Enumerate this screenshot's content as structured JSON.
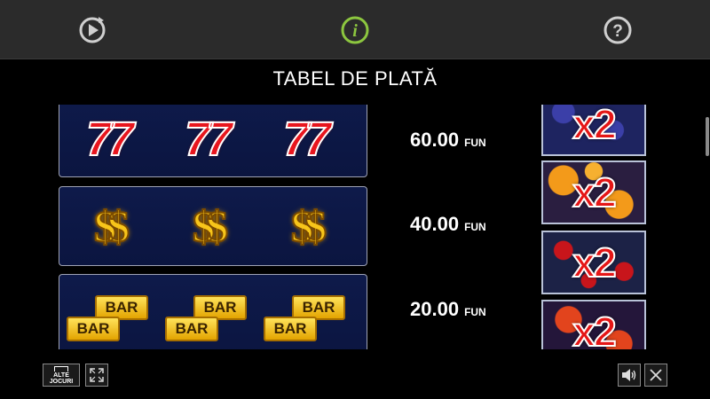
{
  "header": {
    "replay_icon": "replay-icon",
    "info_icon": "info-icon",
    "help_icon": "help-icon",
    "info_color": "#8cc63f"
  },
  "title": "TABEL DE PLATĂ",
  "paytable": [
    {
      "symbol": "seven",
      "glyph": "77",
      "payout": "60.00",
      "unit": "FUN",
      "multiplier": "x2",
      "multiplier_theme": "grapes"
    },
    {
      "symbol": "dollar",
      "glyph": "$$",
      "payout": "40.00",
      "unit": "FUN",
      "multiplier": "x2",
      "multiplier_theme": "oranges"
    },
    {
      "symbol": "bar",
      "glyph": "BAR",
      "payout": "20.00",
      "unit": "FUN",
      "multiplier": "x2",
      "multiplier_theme": "cherries"
    },
    {
      "multiplier": "x2",
      "multiplier_theme": "tomatoes"
    }
  ],
  "footer": {
    "other_games_line1": "ALTE",
    "other_games_line2": "JOCURI",
    "fullscreen_icon": "expand-icon",
    "sound_icon": "speaker-icon",
    "close_icon": "close-icon"
  }
}
